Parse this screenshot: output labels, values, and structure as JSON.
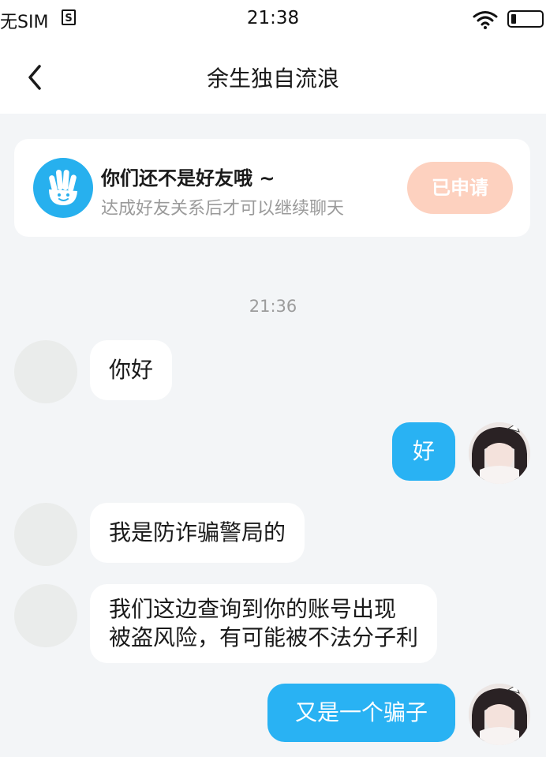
{
  "status_bar": {
    "carrier": "无SIM",
    "sim_icon_letter": "S",
    "time": "21:38"
  },
  "nav": {
    "title": "余生独自流浪"
  },
  "friend_notice": {
    "title": "你们还不是好友哦 ~",
    "subtitle": "达成好友关系后才可以继续聊天",
    "button_label": "已申请"
  },
  "chat": {
    "timestamp": "21:36",
    "messages": [
      {
        "direction": "incoming",
        "text": "你好"
      },
      {
        "direction": "outgoing",
        "text": "好"
      },
      {
        "direction": "incoming",
        "text": "我是防诈骗警局的"
      },
      {
        "direction": "incoming",
        "lines": [
          "我们这边查询到你的账号出现",
          "被盗风险，有可能被不法分子利"
        ]
      },
      {
        "direction": "outgoing",
        "text": "又是一个骗子"
      }
    ]
  },
  "colors": {
    "accent_blue": "#29b2f3",
    "applied_button": "#fdd1bf",
    "background": "#f3f5f7"
  }
}
